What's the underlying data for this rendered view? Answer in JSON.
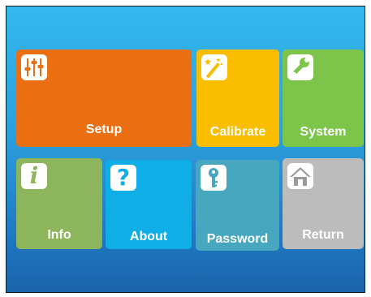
{
  "menu": {
    "tiles": [
      {
        "label": "Setup",
        "icon": "equalizer-sliders-icon",
        "color": "#e96f12"
      },
      {
        "label": "Calibrate",
        "icon": "magic-wand-icon",
        "color": "#fbbd00"
      },
      {
        "label": "System",
        "icon": "wrench-icon",
        "color": "#7cc44a"
      },
      {
        "label": "Info",
        "icon": "info-icon",
        "color": "#8db55b"
      },
      {
        "label": "About",
        "icon": "question-mark-icon",
        "color": "#0faee6"
      },
      {
        "label": "Password",
        "icon": "key-icon",
        "color": "#47a7bf"
      },
      {
        "label": "Return",
        "icon": "home-icon",
        "color": "#bcbcbc"
      }
    ]
  }
}
